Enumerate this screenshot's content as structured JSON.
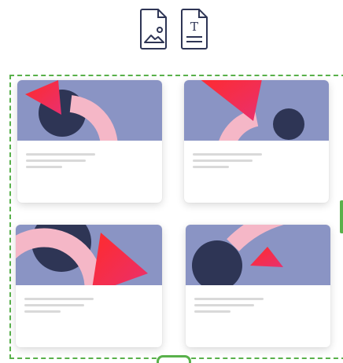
{
  "toolbar": {
    "image_tool": {
      "icon": "image-icon"
    },
    "text_tool": {
      "icon": "text-icon",
      "glyph": "T"
    }
  },
  "cards": [
    {
      "id": "card-1",
      "art": "card-art-1"
    },
    {
      "id": "card-2",
      "art": "card-art-2"
    },
    {
      "id": "card-3",
      "art": "card-art-3"
    },
    {
      "id": "card-4",
      "art": "card-art-4"
    }
  ],
  "colors": {
    "selection_border": "#59b14b",
    "art_background": "#8a94c4",
    "circle": "#2e3555",
    "arc": "#f5b7c7",
    "triangle_gradient_start": "#ff2b2b",
    "triangle_gradient_end": "#e9306f",
    "icon_stroke": "#2e3555",
    "placeholder_text_line": "#d9d9d9"
  }
}
